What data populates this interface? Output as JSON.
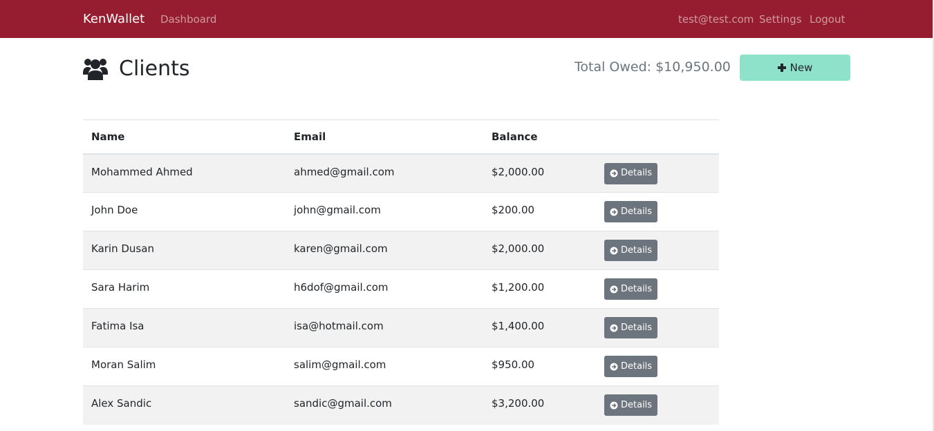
{
  "navbar": {
    "brand": "KenWallet",
    "dashboard": "Dashboard",
    "user_email": "test@test.com",
    "settings": "Settings",
    "logout": "Logout",
    "background_color": "#961c2f"
  },
  "header": {
    "icon": "users-icon",
    "title": "Clients",
    "total_owed": "Total Owed: $10,950.00",
    "new_button": "New",
    "new_button_color": "#8ee2c9"
  },
  "table": {
    "columns": [
      "Name",
      "Email",
      "Balance",
      ""
    ],
    "action_label": "Details",
    "rows": [
      {
        "name": "Mohammed Ahmed",
        "email": "ahmed@gmail.com",
        "balance": "$2,000.00"
      },
      {
        "name": "John Doe",
        "email": "john@gmail.com",
        "balance": "$200.00"
      },
      {
        "name": "Karin Dusan",
        "email": "karen@gmail.com",
        "balance": "$2,000.00"
      },
      {
        "name": "Sara Harim",
        "email": "h6dof@gmail.com",
        "balance": "$1,200.00"
      },
      {
        "name": "Fatima Isa",
        "email": "isa@hotmail.com",
        "balance": "$1,400.00"
      },
      {
        "name": "Moran Salim",
        "email": "salim@gmail.com",
        "balance": "$950.00"
      },
      {
        "name": "Alex Sandic",
        "email": "sandic@gmail.com",
        "balance": "$3,200.00"
      }
    ]
  }
}
